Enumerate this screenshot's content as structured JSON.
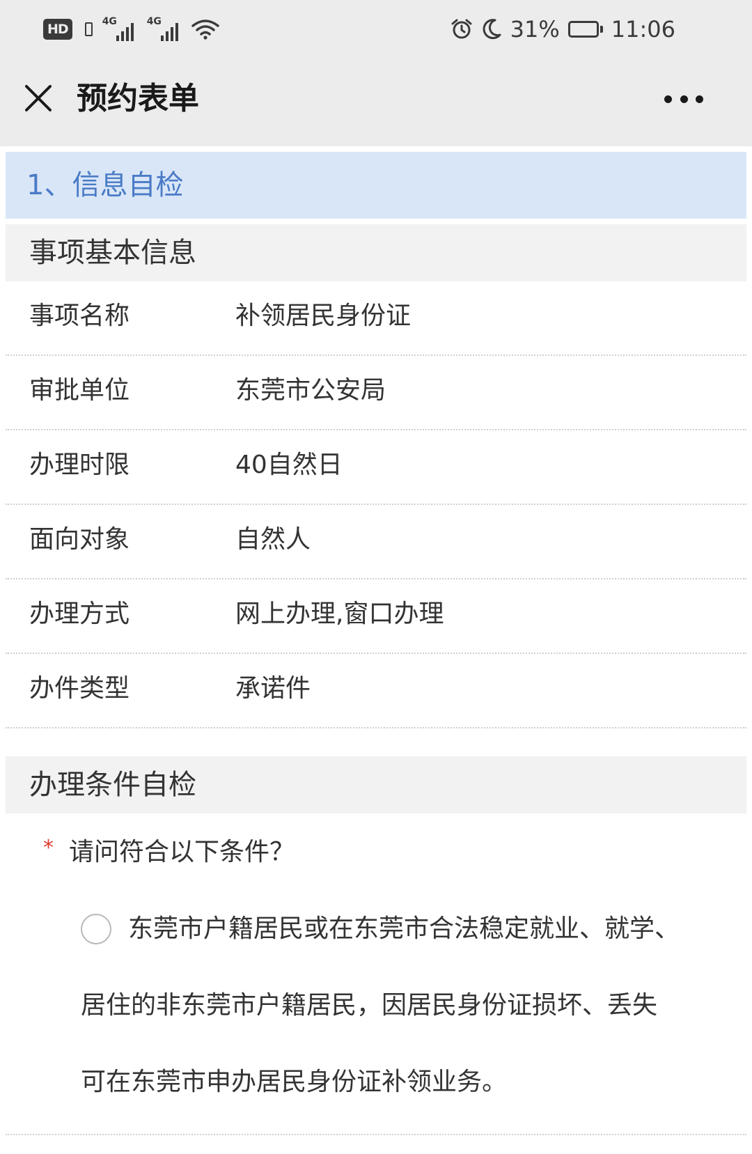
{
  "status_bar": {
    "hd_label": "HD",
    "signal_1": "4G",
    "signal_2": "4G",
    "battery_percent": "31%",
    "battery_level": 0.31,
    "time": "11:06"
  },
  "header": {
    "title": "预约表单"
  },
  "step": {
    "title": "1、信息自检"
  },
  "basic_info": {
    "heading": "事项基本信息",
    "rows": [
      {
        "label": "事项名称",
        "value": "补领居民身份证"
      },
      {
        "label": "审批单位",
        "value": "东莞市公安局"
      },
      {
        "label": "办理时限",
        "value": "40自然日"
      },
      {
        "label": "面向对象",
        "value": "自然人"
      },
      {
        "label": "办理方式",
        "value": "网上办理,窗口办理"
      },
      {
        "label": "办件类型",
        "value": "承诺件"
      }
    ]
  },
  "condition_check": {
    "heading": "办理条件自检",
    "required_mark": "*",
    "question": "请问符合以下条件？",
    "option": {
      "lines": [
        "东莞市户籍居民或在东莞市合法稳定就业、就学、",
        "居住的非东莞市户籍居民，因居民身份证损坏、丢失",
        "可在东莞市申办居民身份证补领业务。"
      ],
      "selected": false
    }
  }
}
